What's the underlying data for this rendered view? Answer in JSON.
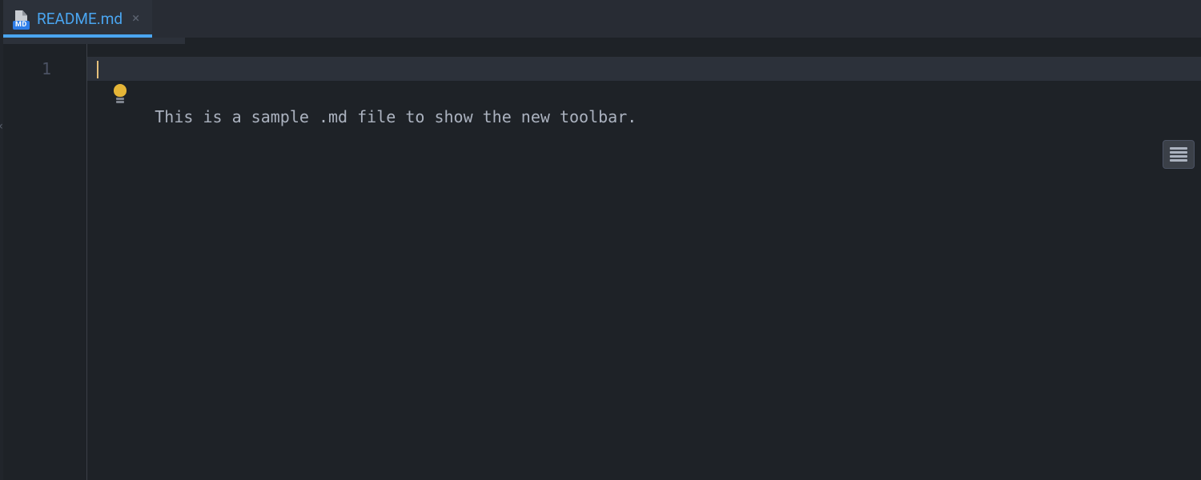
{
  "tab": {
    "filename": "README.md",
    "filetype_badge": "MD",
    "active": true
  },
  "editor": {
    "lines": [
      {
        "number": "1",
        "text": "This is a sample .md file to show the new toolbar."
      }
    ],
    "current_line_index": 0
  },
  "icons": {
    "close": "close-icon",
    "markdown_file": "markdown-file-icon",
    "intention_bulb": "intention-bulb-icon",
    "reader_mode": "reader-mode-icon",
    "tool_window_chevron": "chevron-left-icon"
  }
}
